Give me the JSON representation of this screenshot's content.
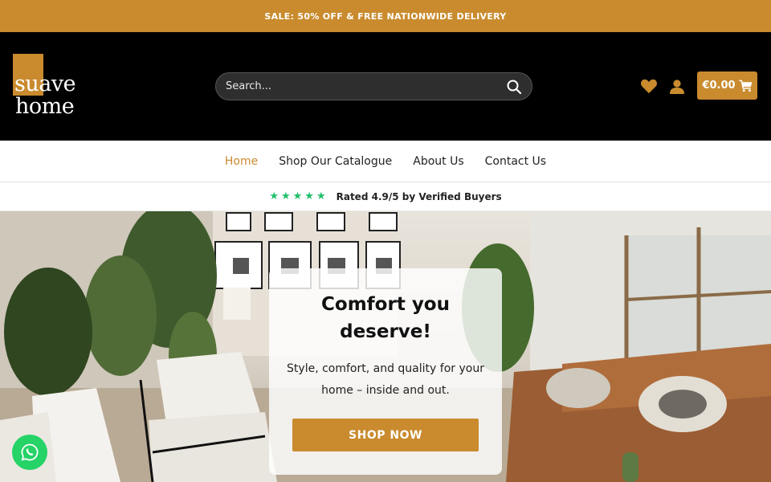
{
  "promo": {
    "text": "SALE: 50% OFF & FREE NATIONWIDE DELIVERY"
  },
  "header": {
    "logo": {
      "line1": "suave",
      "line2": "home"
    },
    "search": {
      "placeholder": "Search..."
    },
    "cart": {
      "amount": "€0.00"
    }
  },
  "icons": {
    "search": "search-icon",
    "wishlist": "heart-icon",
    "account": "user-icon",
    "cart": "shopping-cart-icon",
    "chat": "whatsapp-icon"
  },
  "nav": {
    "items": [
      {
        "label": "Home",
        "active": true
      },
      {
        "label": "Shop Our Catalogue",
        "active": false
      },
      {
        "label": "About Us",
        "active": false
      },
      {
        "label": "Contact Us",
        "active": false
      }
    ]
  },
  "rating": {
    "stars": "★★★★★",
    "text": "Rated 4.9/5 by Verified Buyers"
  },
  "hero": {
    "title": "Comfort you deserve!",
    "subtitle": "Style, comfort, and quality for your home – inside and out.",
    "cta": "SHOP NOW"
  },
  "colors": {
    "accent": "#c98b2e",
    "header_bg": "#000000",
    "star_green": "#1fbf6a",
    "whatsapp_green": "#25d366"
  }
}
